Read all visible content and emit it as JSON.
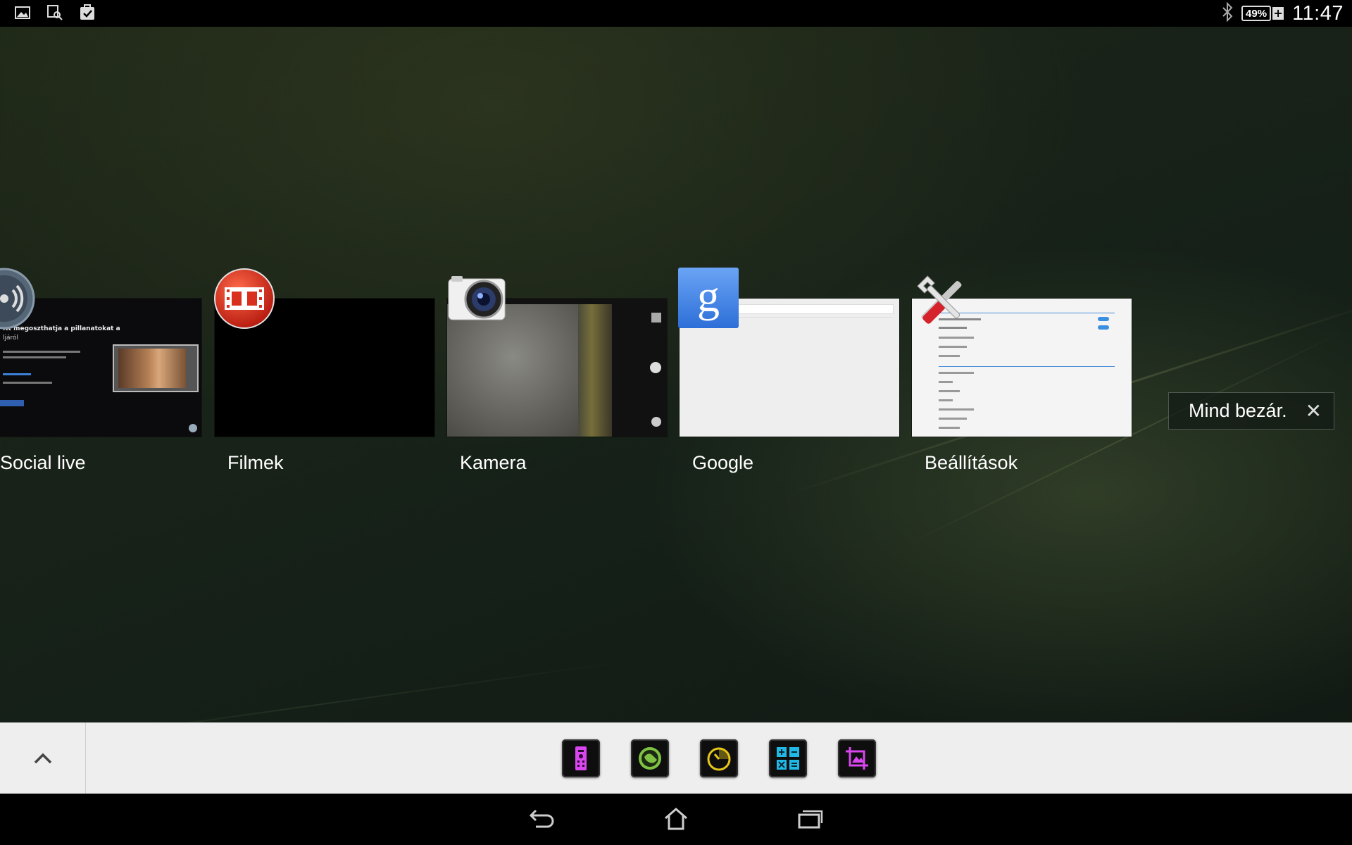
{
  "status_bar": {
    "left_icons": [
      "gallery-icon",
      "screenshot-icon",
      "task-check-icon"
    ],
    "bluetooth_icon": "bluetooth-icon",
    "battery_percent": "49%",
    "battery_charging_icon": "charging-plus-icon",
    "time": "11:47"
  },
  "recent_apps": [
    {
      "label": "Social live",
      "icon": "social-live-icon"
    },
    {
      "label": "Filmek",
      "icon": "movies-icon"
    },
    {
      "label": "Kamera",
      "icon": "camera-icon"
    },
    {
      "label": "Google",
      "icon": "google-icon"
    },
    {
      "label": "Beállítások",
      "icon": "settings-tools-icon"
    }
  ],
  "social_live_thumb": {
    "line1": "Itt megoszthatja a pillanatokat a",
    "line2": "ljáról"
  },
  "close_all": {
    "label": "Mind bezár.",
    "icon": "close-x-icon"
  },
  "dock": {
    "toggle_icon": "chevron-up-icon",
    "small_apps": [
      "remote-icon",
      "browser-globe-icon",
      "timer-icon",
      "calculator-icon",
      "screen-clip-icon"
    ]
  },
  "nav_bar": {
    "back": "back-icon",
    "home": "home-icon",
    "recents": "recents-icon"
  },
  "colors": {
    "accent_magenta": "#d946ef",
    "accent_cyan": "#22b8e6",
    "accent_green": "#7fc243",
    "accent_yellow": "#e6c619"
  }
}
